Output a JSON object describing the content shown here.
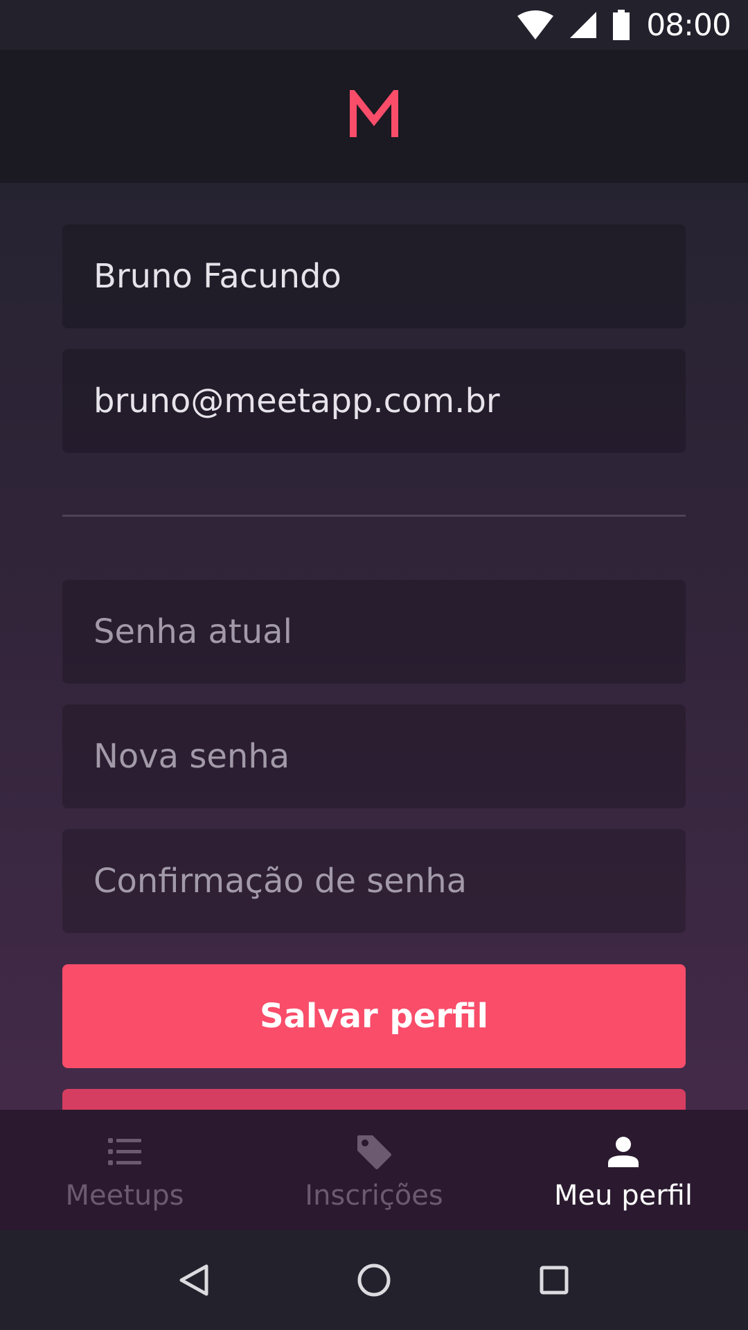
{
  "status_bar": {
    "time": "08:00",
    "icons": [
      "wifi-icon",
      "signal-icon",
      "battery-icon"
    ]
  },
  "header": {
    "logo_text": "M",
    "logo_color": "#f94d6a"
  },
  "profile": {
    "name_value": "Bruno Facundo",
    "email_value": "bruno@meetapp.com.br"
  },
  "password": {
    "current_placeholder": "Senha atual",
    "new_placeholder": "Nova senha",
    "confirm_placeholder": "Confirmação de senha"
  },
  "actions": {
    "save_label": "Salvar perfil",
    "save_color": "#f94d6a"
  },
  "tabs": [
    {
      "label": "Meetups",
      "icon": "list-icon",
      "active": false
    },
    {
      "label": "Inscrições",
      "icon": "tag-icon",
      "active": false
    },
    {
      "label": "Meu perfil",
      "icon": "person-icon",
      "active": true
    }
  ],
  "nav_bar": {
    "icons": [
      "back-icon",
      "home-icon",
      "recents-icon"
    ]
  }
}
